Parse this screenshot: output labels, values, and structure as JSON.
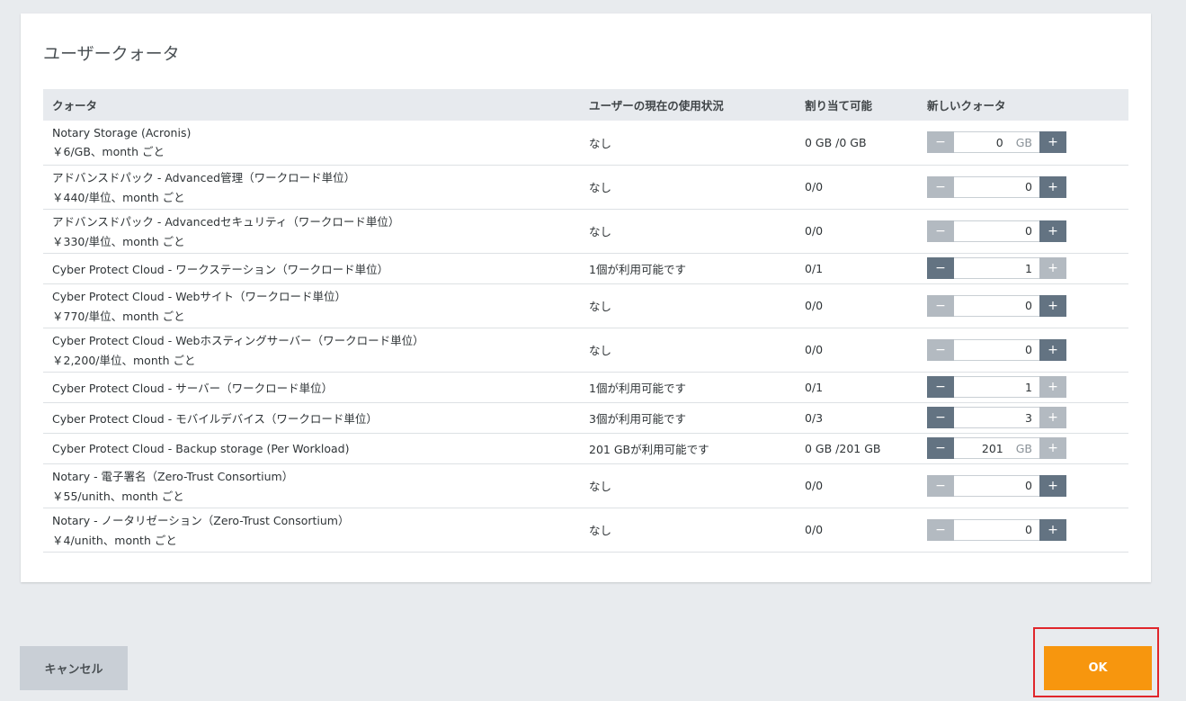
{
  "dialog": {
    "title": "ユーザークォータ",
    "columns": {
      "quota": "クォータ",
      "usage": "ユーザーの現在の使用状況",
      "assignable": "割り当て可能",
      "new_quota": "新しいクォータ"
    },
    "rows": [
      {
        "name": "Notary Storage (Acronis)",
        "price": "￥6/GB、month ごと",
        "usage": "なし",
        "assignable": "0 GB /0 GB",
        "value": "0",
        "unit": "GB",
        "minus_active": false,
        "plus_active": true
      },
      {
        "name": "アドバンスドパック - Advanced管理（ワークロード単位）",
        "price": "￥440/単位、month ごと",
        "usage": "なし",
        "assignable": "0/0",
        "value": "0",
        "unit": "",
        "minus_active": false,
        "plus_active": true
      },
      {
        "name": "アドバンスドパック - Advancedセキュリティ（ワークロード単位）",
        "price": "￥330/単位、month ごと",
        "usage": "なし",
        "assignable": "0/0",
        "value": "0",
        "unit": "",
        "minus_active": false,
        "plus_active": true
      },
      {
        "name": "Cyber Protect Cloud - ワークステーション（ワークロード単位）",
        "price": "",
        "usage": "1個が利用可能です",
        "assignable": "0/1",
        "value": "1",
        "unit": "",
        "minus_active": true,
        "plus_active": false
      },
      {
        "name": "Cyber Protect Cloud - Webサイト（ワークロード単位）",
        "price": "￥770/単位、month ごと",
        "usage": "なし",
        "assignable": "0/0",
        "value": "0",
        "unit": "",
        "minus_active": false,
        "plus_active": true
      },
      {
        "name": "Cyber Protect Cloud - Webホスティングサーバー（ワークロード単位）",
        "price": "￥2,200/単位、month ごと",
        "usage": "なし",
        "assignable": "0/0",
        "value": "0",
        "unit": "",
        "minus_active": false,
        "plus_active": true
      },
      {
        "name": "Cyber Protect Cloud - サーバー（ワークロード単位）",
        "price": "",
        "usage": "1個が利用可能です",
        "assignable": "0/1",
        "value": "1",
        "unit": "",
        "minus_active": true,
        "plus_active": false
      },
      {
        "name": "Cyber Protect Cloud - モバイルデバイス（ワークロード単位）",
        "price": "",
        "usage": "3個が利用可能です",
        "assignable": "0/3",
        "value": "3",
        "unit": "",
        "minus_active": true,
        "plus_active": false
      },
      {
        "name": "Cyber Protect Cloud - Backup storage (Per Workload)",
        "price": "",
        "usage": "201 GBが利用可能です",
        "assignable": "0 GB /201 GB",
        "value": "201",
        "unit": "GB",
        "minus_active": true,
        "plus_active": false
      },
      {
        "name": "Notary - 電子署名（Zero-Trust Consortium）",
        "price": "￥55/unith、month ごと",
        "usage": "なし",
        "assignable": "0/0",
        "value": "0",
        "unit": "",
        "minus_active": false,
        "plus_active": true
      },
      {
        "name": "Notary - ノータリゼーション（Zero-Trust Consortium）",
        "price": "￥4/unith、month ごと",
        "usage": "なし",
        "assignable": "0/0",
        "value": "0",
        "unit": "",
        "minus_active": false,
        "plus_active": true
      }
    ]
  },
  "icons": {
    "minus": "−",
    "plus": "+"
  },
  "colors": {
    "stepper_active": "#637382",
    "stepper_inactive": "#b3bac1",
    "ok_button": "#f7960e",
    "highlight_border": "#e0262b"
  },
  "footer": {
    "cancel_label": "キャンセル",
    "ok_label": "OK"
  }
}
